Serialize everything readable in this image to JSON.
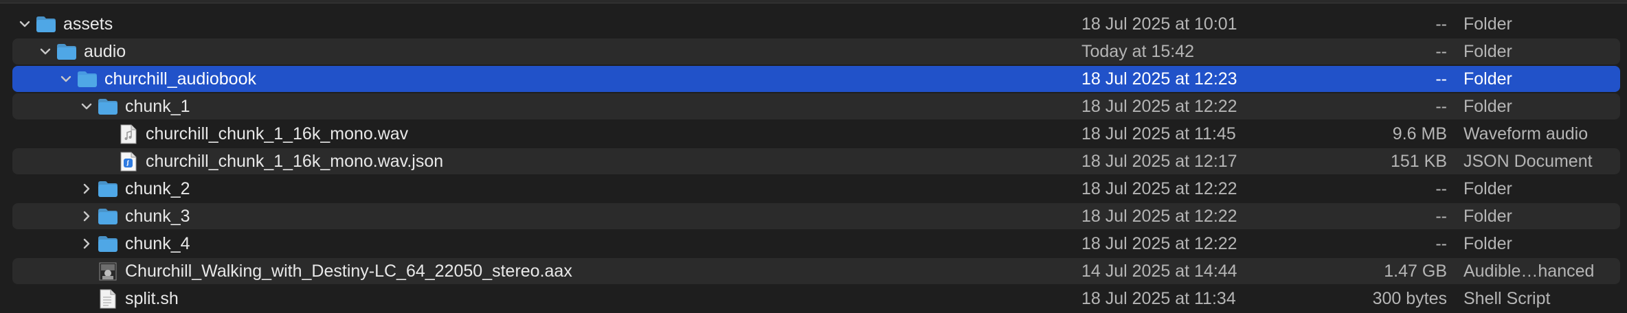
{
  "colors": {
    "background": "#1e1e1e",
    "stripe": "#2b2b2b",
    "selection": "#2152c9",
    "folder": "#4fa7e6",
    "text": "#e8e8e8",
    "secondary_text": "#b5b5b5"
  },
  "rows": [
    {
      "name": "assets",
      "date": "18 Jul 2025 at 10:01",
      "size": "--",
      "kind": "Folder",
      "icon": "folder-icon",
      "disclosure": "expanded",
      "level": 0,
      "selected": false
    },
    {
      "name": "audio",
      "date": "Today at 15:42",
      "size": "--",
      "kind": "Folder",
      "icon": "folder-icon",
      "disclosure": "expanded",
      "level": 1,
      "selected": false
    },
    {
      "name": "churchill_audiobook",
      "date": "18 Jul 2025 at 12:23",
      "size": "--",
      "kind": "Folder",
      "icon": "folder-icon",
      "disclosure": "expanded",
      "level": 2,
      "selected": true
    },
    {
      "name": "chunk_1",
      "date": "18 Jul 2025 at 12:22",
      "size": "--",
      "kind": "Folder",
      "icon": "folder-icon",
      "disclosure": "expanded",
      "level": 3,
      "selected": false
    },
    {
      "name": "churchill_chunk_1_16k_mono.wav",
      "date": "18 Jul 2025 at 11:45",
      "size": "9.6 MB",
      "kind": "Waveform audio",
      "icon": "audio-file-icon",
      "disclosure": "none",
      "level": 4,
      "selected": false
    },
    {
      "name": "churchill_chunk_1_16k_mono.wav.json",
      "date": "18 Jul 2025 at 12:17",
      "size": "151 KB",
      "kind": "JSON Document",
      "icon": "json-file-icon",
      "disclosure": "none",
      "level": 4,
      "selected": false
    },
    {
      "name": "chunk_2",
      "date": "18 Jul 2025 at 12:22",
      "size": "--",
      "kind": "Folder",
      "icon": "folder-icon",
      "disclosure": "collapsed",
      "level": 3,
      "selected": false
    },
    {
      "name": "chunk_3",
      "date": "18 Jul 2025 at 12:22",
      "size": "--",
      "kind": "Folder",
      "icon": "folder-icon",
      "disclosure": "collapsed",
      "level": 3,
      "selected": false
    },
    {
      "name": "chunk_4",
      "date": "18 Jul 2025 at 12:22",
      "size": "--",
      "kind": "Folder",
      "icon": "folder-icon",
      "disclosure": "collapsed",
      "level": 3,
      "selected": false
    },
    {
      "name": "Churchill_Walking_with_Destiny-LC_64_22050_stereo.aax",
      "date": "14 Jul 2025 at 14:44",
      "size": "1.47 GB",
      "kind": "Audible…hanced",
      "icon": "audiobook-thumbnail-icon",
      "disclosure": "none",
      "level": 3,
      "selected": false
    },
    {
      "name": "split.sh",
      "date": "18 Jul 2025 at 11:34",
      "size": "300 bytes",
      "kind": "Shell Script",
      "icon": "shell-script-file-icon",
      "disclosure": "none",
      "level": 3,
      "selected": false
    }
  ]
}
